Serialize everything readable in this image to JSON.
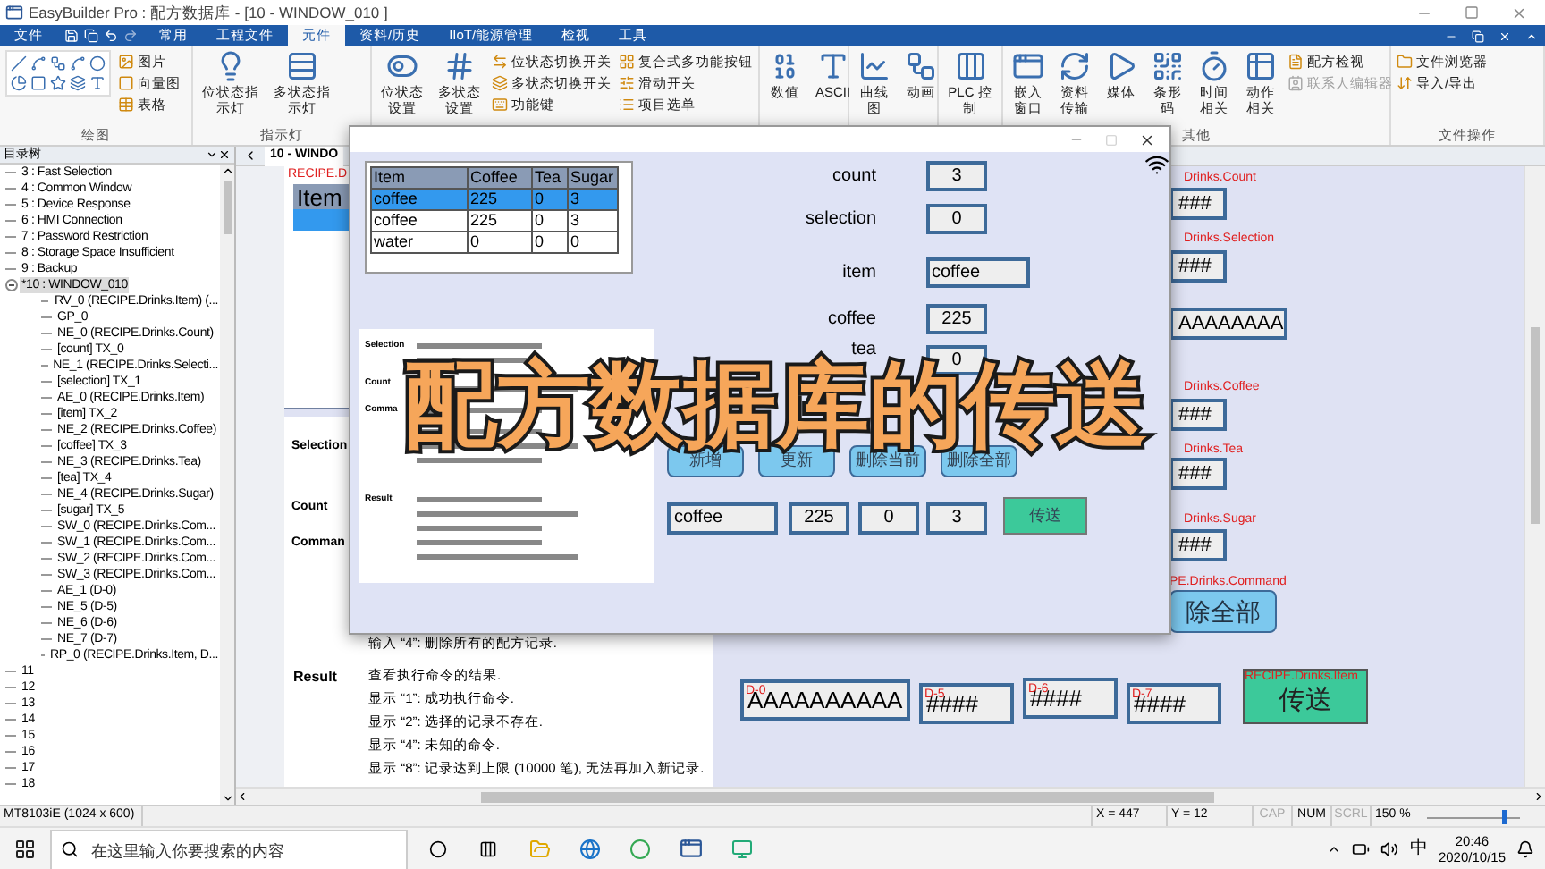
{
  "app_title": "EasyBuilder Pro : 配方数据库 - [10 - WINDOW_010 ]",
  "menu": [
    {
      "label": "文件",
      "selected": false
    },
    {
      "label": "常用",
      "selected": false
    },
    {
      "label": "工程文件",
      "selected": false
    },
    {
      "label": "元件",
      "selected": true
    },
    {
      "label": "资料/历史",
      "selected": false
    },
    {
      "label": "IIoT/能源管理",
      "selected": false
    },
    {
      "label": "检视",
      "selected": false
    },
    {
      "label": "工具",
      "selected": false
    }
  ],
  "ribbon": [
    {
      "kind": "drawing",
      "label": "绘图",
      "items": [
        {
          "label": "图片",
          "kind": "small",
          "disabled": false
        },
        {
          "label": "向量图",
          "kind": "small",
          "disabled": false
        },
        {
          "label": "表格",
          "kind": "small",
          "disabled": false
        }
      ]
    },
    {
      "kind": "buttons",
      "label": "指示灯",
      "items": [
        {
          "label": "位状态指示灯",
          "kind": "large",
          "disabled": false
        },
        {
          "label": "多状态指示灯",
          "kind": "large",
          "disabled": false
        }
      ]
    },
    {
      "kind": "buttons",
      "items": [
        {
          "label": "位状态设置",
          "kind": "large",
          "disabled": false
        },
        {
          "label": "多状态设置",
          "kind": "large",
          "disabled": false
        },
        {
          "label": "位状态切换开关",
          "kind": "small",
          "disabled": false
        },
        {
          "label": "多状态切换开关",
          "kind": "small",
          "disabled": false
        },
        {
          "label": "功能键",
          "kind": "small",
          "disabled": false
        },
        {
          "label": "复合式多功能按钮",
          "kind": "small",
          "disabled": false
        },
        {
          "label": "滑动开关",
          "kind": "small",
          "disabled": false
        },
        {
          "label": "项目选单",
          "kind": "small",
          "disabled": false
        }
      ]
    },
    {
      "kind": "buttons",
      "items": [
        {
          "label": "数值",
          "kind": "large",
          "disabled": false
        },
        {
          "label": "ASCII",
          "kind": "large",
          "disabled": false
        }
      ]
    },
    {
      "kind": "buttons",
      "items": [
        {
          "label": "曲线图",
          "kind": "large",
          "disabled": false
        },
        {
          "label": "动画",
          "kind": "large",
          "disabled": false
        }
      ]
    },
    {
      "kind": "buttons",
      "items": [
        {
          "label": "PLC 控制",
          "kind": "large",
          "disabled": false
        }
      ]
    },
    {
      "kind": "buttons",
      "label": "其他",
      "items": [
        {
          "label": "嵌入窗口",
          "kind": "large",
          "disabled": false
        },
        {
          "label": "资料传输",
          "kind": "large",
          "disabled": false
        },
        {
          "label": "媒体",
          "kind": "large",
          "disabled": false
        },
        {
          "label": "条形码",
          "kind": "large",
          "disabled": false
        },
        {
          "label": "时间相关",
          "kind": "large",
          "disabled": false
        },
        {
          "label": "动作相关",
          "kind": "large",
          "disabled": false
        },
        {
          "label": "配方检视",
          "kind": "small",
          "disabled": false
        },
        {
          "label": "联系人编辑器",
          "kind": "small",
          "disabled": true
        }
      ]
    },
    {
      "kind": "buttons",
      "label": "文件操作",
      "items": [
        {
          "label": "文件浏览器",
          "kind": "small",
          "disabled": false
        },
        {
          "label": "导入/导出",
          "kind": "small",
          "disabled": false
        }
      ]
    }
  ],
  "tree": {
    "title": "目录树",
    "items": [
      {
        "label": "3 : Fast Selection",
        "selected": false
      },
      {
        "label": "4 : Common Window",
        "selected": false
      },
      {
        "label": "5 : Device Response",
        "selected": false
      },
      {
        "label": "6 : HMI Connection",
        "selected": false
      },
      {
        "label": "7 : Password Restriction",
        "selected": false
      },
      {
        "label": "8 : Storage Space Insufficient",
        "selected": false
      },
      {
        "label": "9 : Backup",
        "selected": false
      },
      {
        "label": "*10 : WINDOW_010",
        "selected": true,
        "expanded": true,
        "children": [
          {
            "label": "RV_0 (RECIPE.Drinks.Item) (...",
            "selected": false
          },
          {
            "label": "GP_0",
            "selected": false
          },
          {
            "label": "NE_0 (RECIPE.Drinks.Count)",
            "selected": false
          },
          {
            "label": "[count] TX_0",
            "selected": false
          },
          {
            "label": "NE_1 (RECIPE.Drinks.Selecti...",
            "selected": false
          },
          {
            "label": "[selection] TX_1",
            "selected": false
          },
          {
            "label": "AE_0 (RECIPE.Drinks.Item)",
            "selected": false
          },
          {
            "label": "[item] TX_2",
            "selected": false
          },
          {
            "label": "NE_2 (RECIPE.Drinks.Coffee)",
            "selected": false
          },
          {
            "label": "[coffee] TX_3",
            "selected": false
          },
          {
            "label": "NE_3 (RECIPE.Drinks.Tea)",
            "selected": false
          },
          {
            "label": "[tea] TX_4",
            "selected": false
          },
          {
            "label": "NE_4 (RECIPE.Drinks.Sugar)",
            "selected": false
          },
          {
            "label": "[sugar] TX_5",
            "selected": false
          },
          {
            "label": "SW_0 (RECIPE.Drinks.Com...",
            "selected": false
          },
          {
            "label": "SW_1 (RECIPE.Drinks.Com...",
            "selected": false
          },
          {
            "label": "SW_2 (RECIPE.Drinks.Com...",
            "selected": false
          },
          {
            "label": "SW_3 (RECIPE.Drinks.Com...",
            "selected": false
          },
          {
            "label": "AE_1 (D-0)",
            "selected": false
          },
          {
            "label": "NE_5 (D-5)",
            "selected": false
          },
          {
            "label": "NE_6 (D-6)",
            "selected": false
          },
          {
            "label": "NE_7 (D-7)",
            "selected": false
          },
          {
            "label": "RP_0 (RECIPE.Drinks.Item, D...",
            "selected": false
          }
        ]
      },
      {
        "label": "11",
        "selected": false
      },
      {
        "label": "12",
        "selected": false
      },
      {
        "label": "13",
        "selected": false
      },
      {
        "label": "14",
        "selected": false
      },
      {
        "label": "15",
        "selected": false
      },
      {
        "label": "16",
        "selected": false
      },
      {
        "label": "17",
        "selected": false
      },
      {
        "label": "18",
        "selected": false
      }
    ]
  },
  "editor_tab": "10 - WINDO",
  "canvas": {
    "recipe_tag": "RECIPE.D",
    "item_header": "Item",
    "doc_labels": [
      "Selection",
      "Count",
      "Comman"
    ],
    "doc_line": "输入 “4”: 删除所有的配方记录.",
    "result_label": "Result",
    "result_lines": [
      "查看执行命令的结果.",
      "显示 “1”: 成功执行命令.",
      "显示 “2”: 选择的记录不存在.",
      "显示 “4”: 未知的命令.",
      "显示 “8”: 记录达到上限 (10000 笔), 无法再加入新记录."
    ],
    "side_tags": [
      "Drinks.Count",
      "Drinks.Selection",
      "Drinks.Coffee",
      "Drinks.Tea",
      "Drinks.Sugar",
      "PE.Drinks.Command"
    ],
    "side_boxes": [
      "###",
      "###",
      "AAAAAAAA",
      "###",
      "###",
      "###"
    ],
    "side_button": "除全部",
    "bottom_fields": [
      {
        "tag": "D-0",
        "value": "AAAAAAAAAA"
      },
      {
        "tag": "D-5",
        "value": "####"
      },
      {
        "tag": "D-6",
        "value": "####"
      },
      {
        "tag": "D-7",
        "value": "####"
      }
    ],
    "send_button": {
      "tag": "RECIPE.Drinks.Item",
      "label": "传送"
    }
  },
  "dialog": {
    "table": {
      "columns": [
        "Item",
        "Coffee",
        "Tea",
        "Sugar"
      ],
      "rows": [
        {
          "cells": [
            "coffee",
            "225",
            "0",
            "3"
          ],
          "selected": true
        },
        {
          "cells": [
            "coffee",
            "225",
            "0",
            "3"
          ],
          "selected": false
        },
        {
          "cells": [
            "water",
            "0",
            "0",
            "0"
          ],
          "selected": false
        }
      ]
    },
    "doc_labels": [
      "Selection",
      "Count",
      "Comma",
      "Result"
    ],
    "fields": [
      {
        "label": "count",
        "value": "3"
      },
      {
        "label": "selection",
        "value": "0"
      },
      {
        "label": "item",
        "value": "coffee"
      },
      {
        "label": "coffee",
        "value": "225"
      },
      {
        "label": "tea",
        "value": "0"
      }
    ],
    "buttons": [
      "新增",
      "更新",
      "删除当前",
      "删除全部"
    ],
    "entry": [
      "coffee",
      "225",
      "0",
      "3"
    ],
    "send_button": "传送"
  },
  "caption": "配方数据库的传送",
  "status_bar": {
    "device": "MT8103iE (1024 x 600)",
    "x": "X = 447",
    "y": "Y = 12",
    "keys": [
      {
        "label": "CAP",
        "on": false
      },
      {
        "label": "NUM",
        "on": true
      },
      {
        "label": "SCRL",
        "on": false
      }
    ],
    "zoom": "150 %",
    "zoom_slider": {
      "level": 0.82
    }
  },
  "taskbar": {
    "search": {
      "placeholder": "在这里输入你要搜索的内容"
    },
    "ime": "中",
    "time": "20:46",
    "date": "2020/10/15"
  }
}
